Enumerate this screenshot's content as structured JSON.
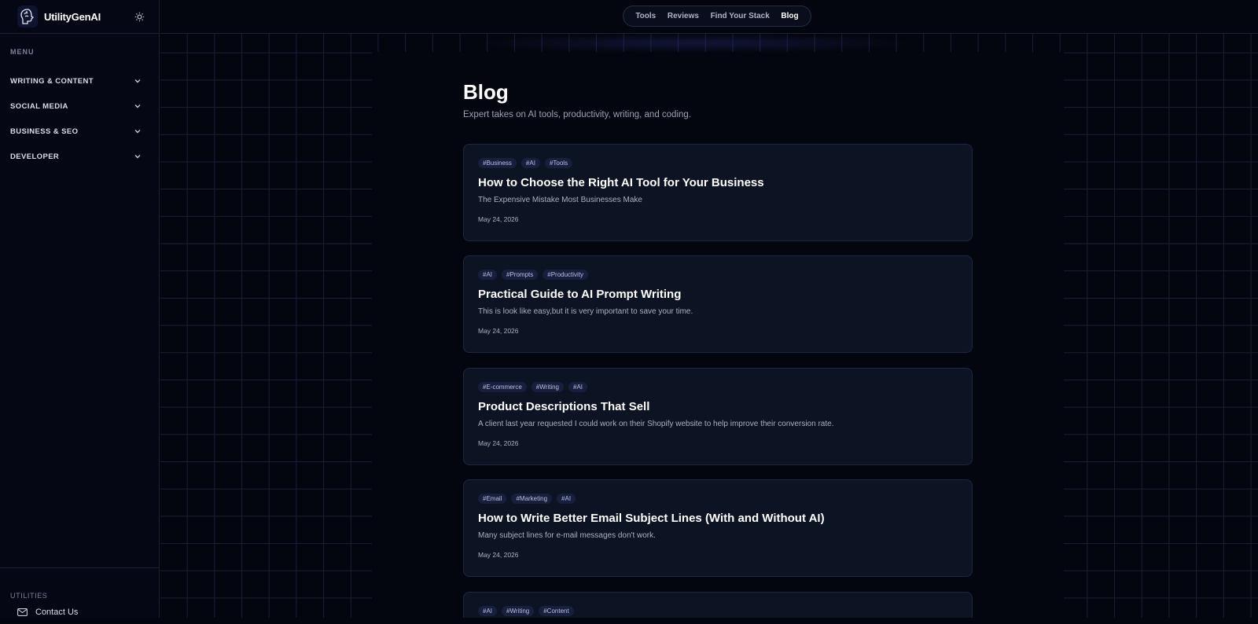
{
  "brand": {
    "name": "UtilityGenAI"
  },
  "sidebar": {
    "menu_label": "MENU",
    "items": [
      {
        "label": "WRITING & CONTENT"
      },
      {
        "label": "SOCIAL MEDIA"
      },
      {
        "label": "BUSINESS & SEO"
      },
      {
        "label": "DEVELOPER"
      }
    ],
    "utilities_label": "UTILITIES",
    "contact_label": "Contact Us"
  },
  "nav": {
    "items": [
      {
        "label": "Tools"
      },
      {
        "label": "Reviews"
      },
      {
        "label": "Find Your Stack"
      },
      {
        "label": "Blog"
      }
    ],
    "active": "Blog"
  },
  "page": {
    "title": "Blog",
    "subtitle": "Expert takes on AI tools, productivity, writing, and coding."
  },
  "posts": [
    {
      "tags": [
        "#Business",
        "#AI",
        "#Tools"
      ],
      "title": "How to Choose the Right AI Tool for Your Business",
      "excerpt": "The Expensive Mistake Most Businesses Make",
      "date": "May 24, 2026"
    },
    {
      "tags": [
        "#AI",
        "#Prompts",
        "#Productivity"
      ],
      "title": "Practical Guide to AI Prompt Writing",
      "excerpt": "This is look like easy,but it is very important to save your time.",
      "date": "May 24, 2026"
    },
    {
      "tags": [
        "#E-commerce",
        "#Writing",
        "#AI"
      ],
      "title": "Product Descriptions That Sell",
      "excerpt": "A client last year requested I could work on their Shopify website to help improve their conversion rate.",
      "date": "May 24, 2026"
    },
    {
      "tags": [
        "#Email",
        "#Marketing",
        "#AI"
      ],
      "title": "How to Write Better Email Subject Lines (With and Without AI)",
      "excerpt": "Many subject lines for e-mail messages don't work.",
      "date": "May 24, 2026"
    },
    {
      "tags": [
        "#AI",
        "#Writing",
        "#Content"
      ],
      "title": "",
      "excerpt": "",
      "date": ""
    }
  ],
  "colors": {
    "background": "#04060f",
    "card": "#0c1322",
    "tag_bg": "#171f3d",
    "grid": "#1a2034"
  }
}
